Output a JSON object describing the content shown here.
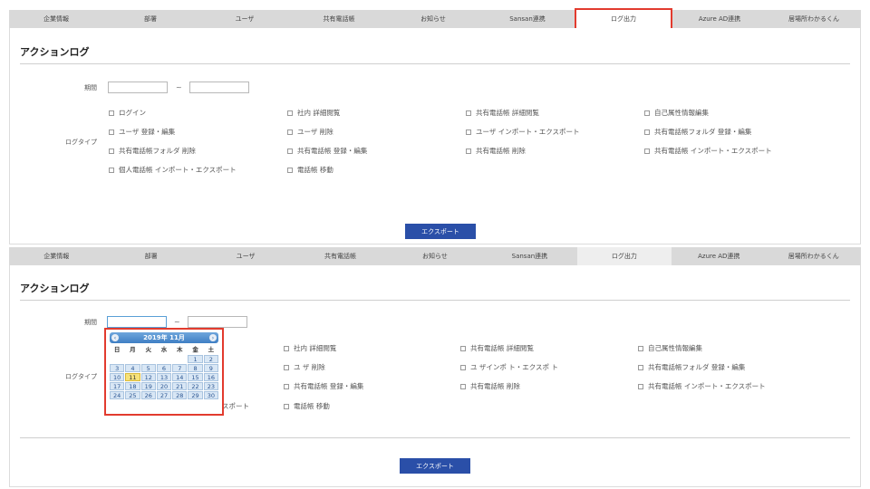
{
  "nav": {
    "tabs": [
      "企業情報",
      "部署",
      "ユーザ",
      "共有電話帳",
      "お知らせ",
      "Sansan連携",
      "ログ出力",
      "Azure AD連携",
      "居場所わかるくん"
    ],
    "active_index": 6
  },
  "page": {
    "title": "アクションログ",
    "period_label": "期間",
    "tilde": "~",
    "logtype_label": "ログタイプ",
    "export_label": "エクスポート"
  },
  "logtypes_top": [
    "ログイン",
    "社内 詳細閲覧",
    "共有電話帳 詳細閲覧",
    "自己属性情報編集",
    "ユーザ 登録・編集",
    "ユーザ 削除",
    "ユーザ インポート・エクスポート",
    "共有電話帳フォルダ 登録・編集",
    "共有電話帳フォルダ 削除",
    "共有電話帳 登録・編集",
    "共有電話帳 削除",
    "共有電話帳 インポート・エクスポート",
    "個人電話帳 インポート・エクスポート",
    "電話帳 移動"
  ],
  "logtypes_bottom": {
    "partial_left": "スポート",
    "items": [
      "社内 詳細閲覧",
      "共有電話帳 詳細閲覧",
      "自己属性情報編集",
      "ユ ザ 削除",
      "ユ ザインポ ト・エクスポ ト",
      "共有電話帳フォルダ 登録・編集",
      "共有電話帳 登録・編集",
      "共有電話帳 削除",
      "共有電話帳 インポート・エクスポート",
      "電話帳 移動"
    ]
  },
  "calendar": {
    "title": "2019年 11月",
    "prev_icon": "‹",
    "next_icon": "›",
    "weekdays": [
      "日",
      "月",
      "火",
      "水",
      "木",
      "金",
      "土"
    ],
    "leading_blanks": 5,
    "days": [
      "1",
      "2",
      "3",
      "4",
      "5",
      "6",
      "7",
      "8",
      "9",
      "10",
      "11",
      "12",
      "13",
      "14",
      "15",
      "16",
      "17",
      "18",
      "19",
      "20",
      "21",
      "22",
      "23",
      "24",
      "25",
      "26",
      "27",
      "28",
      "29",
      "30"
    ],
    "today": "11"
  },
  "colors": {
    "accent": "#2a4fa8",
    "highlight": "#e23b2e",
    "today": "#f7e27a"
  }
}
